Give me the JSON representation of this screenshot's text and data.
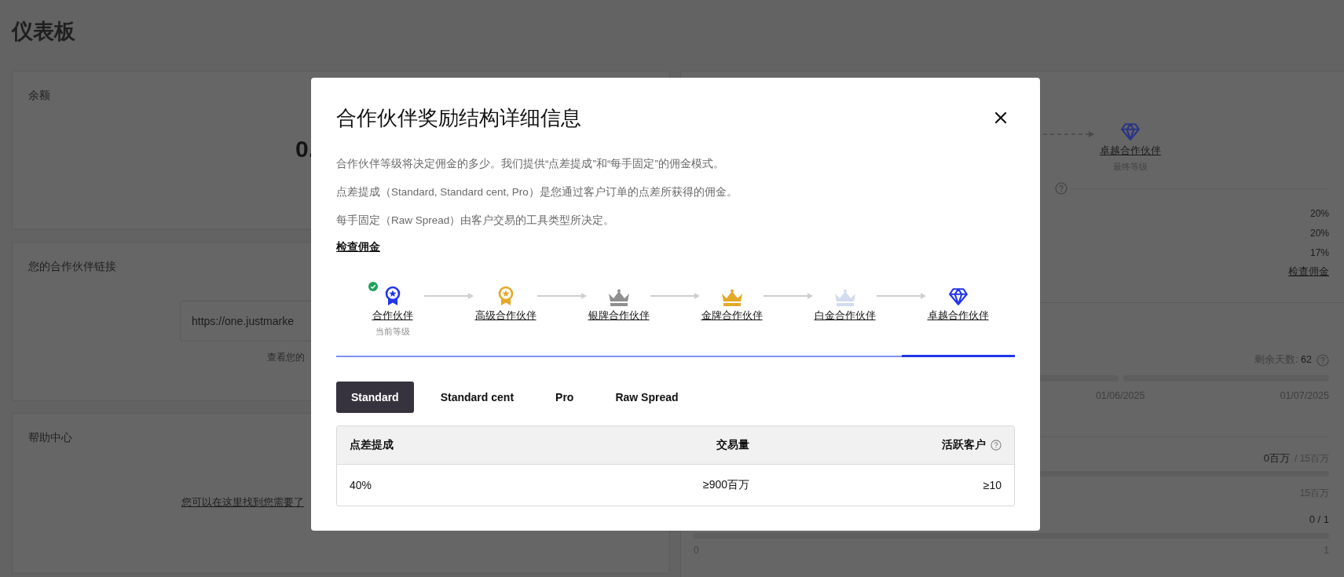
{
  "page": {
    "title": "仪表板"
  },
  "balance_card": {
    "label": "余额",
    "amount": "0."
  },
  "partner_link_card": {
    "label": "您的合作伙伴链接",
    "link_value": "https://one.justmarke",
    "caption": "查看您的"
  },
  "help_card": {
    "label": "帮助中心",
    "link": "您可以在这里找到您需要了"
  },
  "tier_card": {
    "final_tier": {
      "name": "卓越合作伙伴",
      "caption": "最终等级"
    },
    "rates": [
      "20%",
      "20%",
      "17%"
    ],
    "link": "检查佣金"
  },
  "period_card": {
    "days_left_label": "剩余天数:",
    "days_left": "62",
    "dates": [
      "01/06/2025",
      "01/07/2025"
    ]
  },
  "volume": {
    "current": "0百万",
    "target": "/ 15百万",
    "level": 0,
    "scale_max": "15百万"
  },
  "clients": {
    "count": "0 / 1",
    "level": 0,
    "scale_min": "0",
    "scale_max": "1"
  },
  "modal": {
    "title": "合作伙伴奖励结构详细信息",
    "paragraphs": [
      "合作伙伴等级将决定佣金的多少。我们提供“点差提成”和“每手固定”的佣金模式。",
      "点差提成（Standard, Standard cent, Pro）是您通过客户订单的点差所获得的佣金。",
      "每手固定（Raw Spread）由客户交易的工具类型所决定。"
    ],
    "link": "检查佣金",
    "tiers": [
      {
        "name": "合作伙伴",
        "caption": "当前等级",
        "current": true,
        "selected": false,
        "kind": "medal",
        "color": "#2235ea"
      },
      {
        "name": "高级合作伙伴",
        "current": false,
        "selected": false,
        "kind": "medal",
        "color": "#e5a826"
      },
      {
        "name": "银牌合作伙伴",
        "current": false,
        "selected": false,
        "kind": "crown",
        "color": "#8f8f8f"
      },
      {
        "name": "金牌合作伙伴",
        "current": false,
        "selected": false,
        "kind": "crown",
        "color": "#e5a826"
      },
      {
        "name": "白金合作伙伴",
        "current": false,
        "selected": false,
        "kind": "crown",
        "color": "#d3dbef"
      },
      {
        "name": "卓越合作伙伴",
        "current": false,
        "selected": true,
        "kind": "diamond",
        "color": "#2235ea"
      }
    ],
    "account_tabs": [
      {
        "label": "Standard",
        "selected": true
      },
      {
        "label": "Standard cent",
        "selected": false
      },
      {
        "label": "Pro",
        "selected": false
      },
      {
        "label": "Raw Spread",
        "selected": false
      }
    ],
    "table": {
      "columns": [
        "点差提成",
        "交易量",
        "活跃客户"
      ],
      "rows": [
        [
          "40%",
          "≥900百万",
          "≥10"
        ]
      ]
    }
  }
}
